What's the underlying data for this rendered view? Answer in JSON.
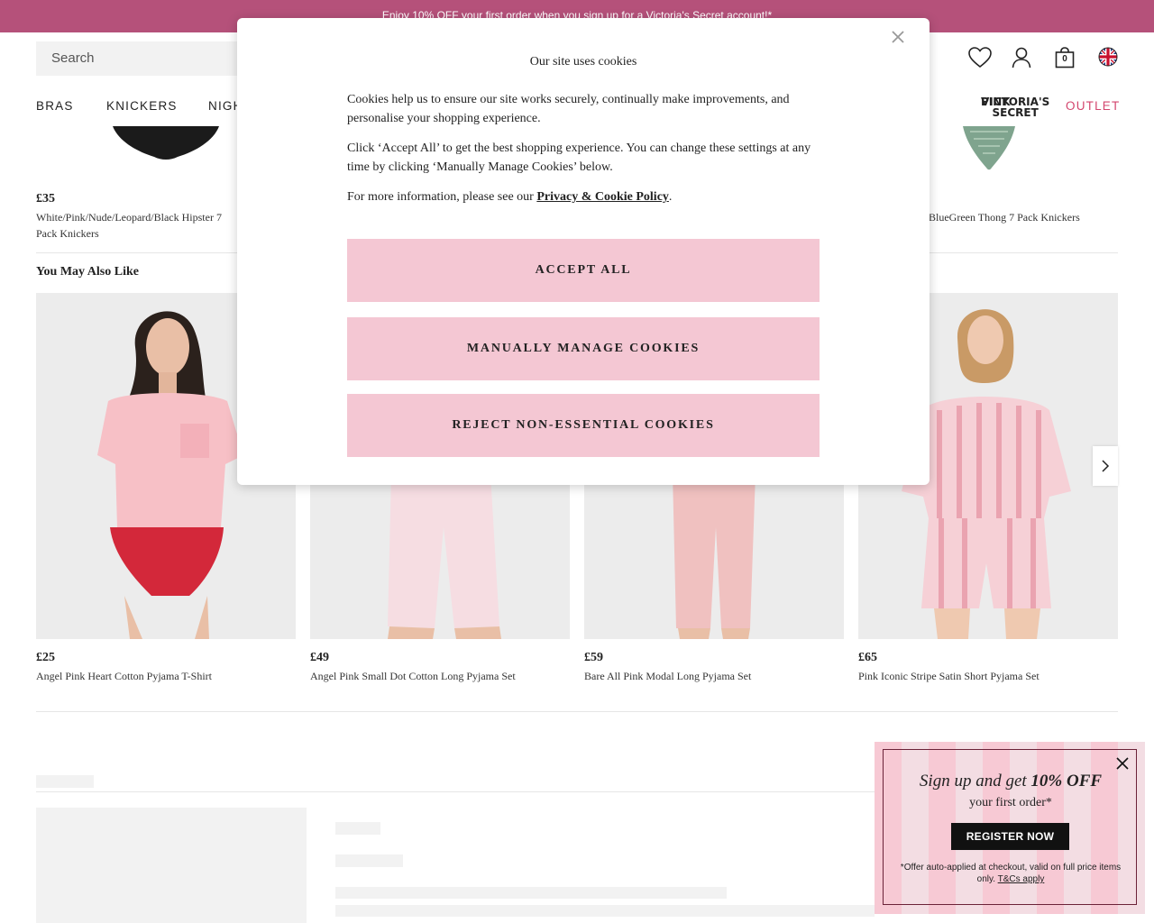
{
  "promo": {
    "text": "Enjoy 10% OFF your first order when you sign up for a Victoria's Secret account!*"
  },
  "header": {
    "search_placeholder": "Search",
    "bag_count": "0",
    "icons": [
      "heart-icon",
      "account-icon",
      "bag-icon",
      "uk-flag-icon"
    ]
  },
  "nav": {
    "items": [
      "BRAS",
      "KNICKERS",
      "NIGH"
    ],
    "pink_logo_line1": "VICTORIA'S SECRET",
    "pink_logo_line2": "PINK",
    "outlet": "OUTLET"
  },
  "top_products": [
    {
      "price": "£35",
      "name": "White/Pink/Nude/Leopard/Black Hipster 7 Pack Knickers"
    },
    {
      "price": "",
      "name": "BlueGreen Thong 7 Pack Knickers"
    }
  ],
  "ymal": {
    "title": "You May Also Like",
    "products": [
      {
        "price": "£25",
        "name": "Angel Pink Heart Cotton Pyjama T-Shirt"
      },
      {
        "price": "£49",
        "name": "Angel Pink Small Dot Cotton Long Pyjama Set"
      },
      {
        "price": "£59",
        "name": "Bare All Pink Modal Long Pyjama Set"
      },
      {
        "price": "£65",
        "name": "Pink Iconic Stripe Satin Short Pyjama Set"
      }
    ]
  },
  "cookie_modal": {
    "title": "Our site uses cookies",
    "p1": "Cookies help us to ensure our site works securely, continually make improvements, and personalise your shopping experience.",
    "p2": "Click ‘Accept All’ to get the best shopping experience. You can change these settings at any time by clicking ‘Manually Manage Cookies’ below.",
    "p3_prefix": "For more information, please see our ",
    "p3_link": "Privacy & Cookie Policy",
    "p3_suffix": ".",
    "accept": "ACCEPT ALL",
    "manage": "MANUALLY MANAGE COOKIES",
    "reject": "REJECT NON-ESSENTIAL COOKIES"
  },
  "signup": {
    "head_prefix": "Sign up and get ",
    "head_bold": "10% OFF",
    "sub": "your first order*",
    "button": "REGISTER NOW",
    "fine_prefix": "*Offer auto-applied at checkout, valid on full price items only. ",
    "fine_link": "T&Cs apply"
  },
  "colors": {
    "promo_bar": "#b5517a",
    "cookie_button": "#f4c7d3",
    "outlet": "#d3466e"
  }
}
